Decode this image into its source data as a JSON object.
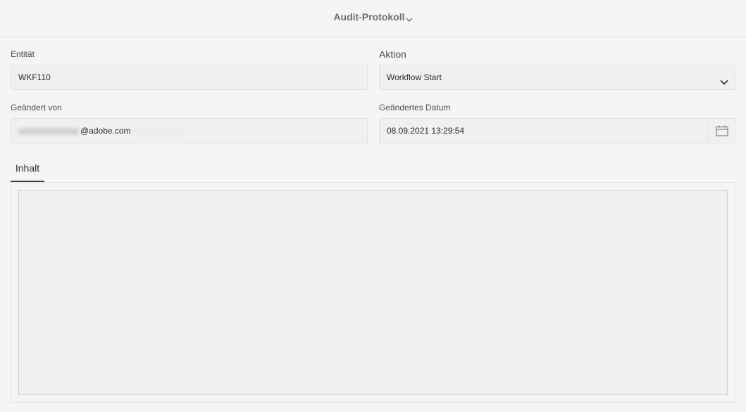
{
  "header": {
    "title": "Audit-Protokoll"
  },
  "form": {
    "entity": {
      "label": "Entität",
      "value": "WKF110"
    },
    "action": {
      "label": "Aktion",
      "value": "Workflow Start"
    },
    "changed_by": {
      "label": "Geändert von",
      "value_suffix": "@adobe.com"
    },
    "changed_date": {
      "label": "Geändertes Datum",
      "value": "08.09.2021 13:29:54"
    }
  },
  "tabs": [
    {
      "label": "Inhalt"
    }
  ],
  "content": {
    "value": ""
  },
  "icons": {
    "header_dropdown": "chevron-down-icon",
    "action_select": "chevron-down-icon",
    "date_picker": "calendar-icon"
  },
  "colors": {
    "background": "#f5f5f5",
    "field": "#f0f0f0",
    "tab_indicator": "#3a3a3a"
  }
}
